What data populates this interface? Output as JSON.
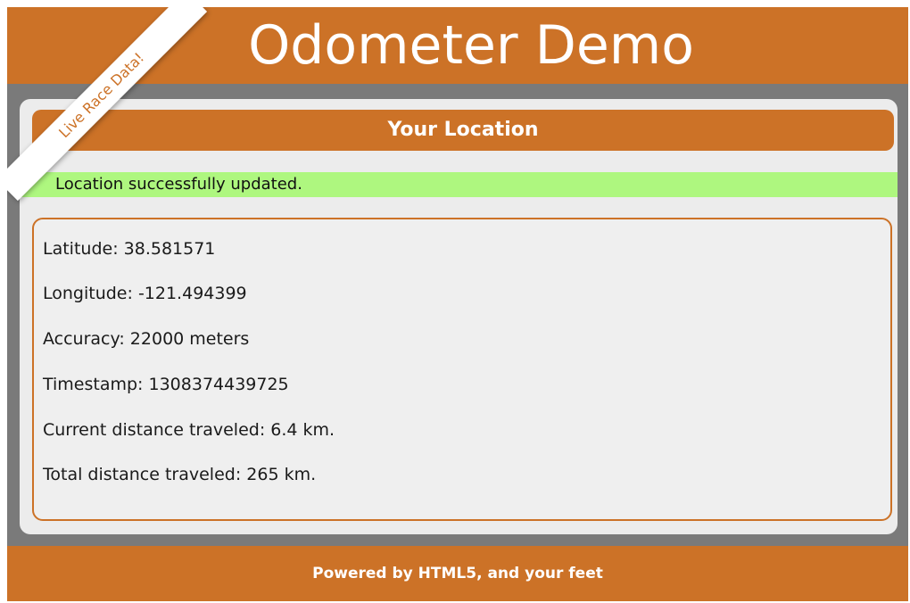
{
  "header": {
    "title": "Odometer Demo"
  },
  "ribbon": {
    "label": "Live Race Data!"
  },
  "section": {
    "title": "Your Location"
  },
  "status": {
    "message": "Location successfully updated.",
    "color": "#aef77f"
  },
  "details": {
    "latitude": "Latitude: 38.581571",
    "longitude": "Longitude: -121.494399",
    "accuracy": "Accuracy: 22000 meters",
    "timestamp": "Timestamp: 1308374439725",
    "current_distance": "Current distance traveled: 6.4 km.",
    "total_distance": "Total distance traveled: 265 km."
  },
  "footer": {
    "text": "Powered by HTML5, and your feet"
  },
  "colors": {
    "accent": "#cc7227",
    "frame": "#7a7a7a",
    "panel": "#ececec"
  }
}
